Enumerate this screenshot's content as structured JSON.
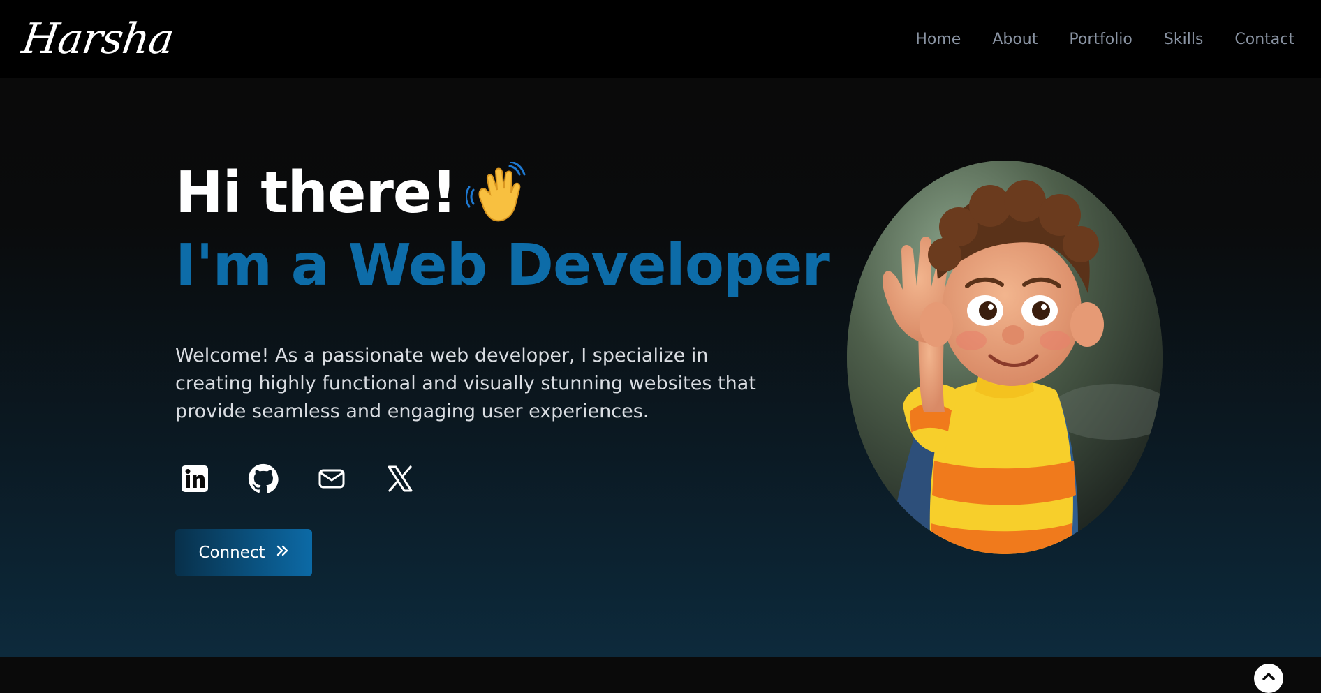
{
  "nav": {
    "logo": "Harsha",
    "links": [
      "Home",
      "About",
      "Portfolio",
      "Skills",
      "Contact"
    ]
  },
  "hero": {
    "greeting": "Hi there!",
    "role": "I'm a Web Developer",
    "intro": "Welcome! As a passionate web developer, I specialize in creating highly functional and visually stunning websites that provide seamless and engaging user experiences.",
    "connect_label": "Connect"
  },
  "icons": {
    "wave": "waving-hand-icon",
    "socials": [
      "linkedin-icon",
      "github-icon",
      "mail-icon",
      "x-twitter-icon"
    ],
    "connect": "double-chevron-right-icon",
    "scroll_top": "chevron-up-icon"
  },
  "colors": {
    "accent": "#0d6ca8",
    "nav_text": "#8a94a3",
    "background_top": "#0a0a0a",
    "background_bottom": "#0d2a3c"
  }
}
